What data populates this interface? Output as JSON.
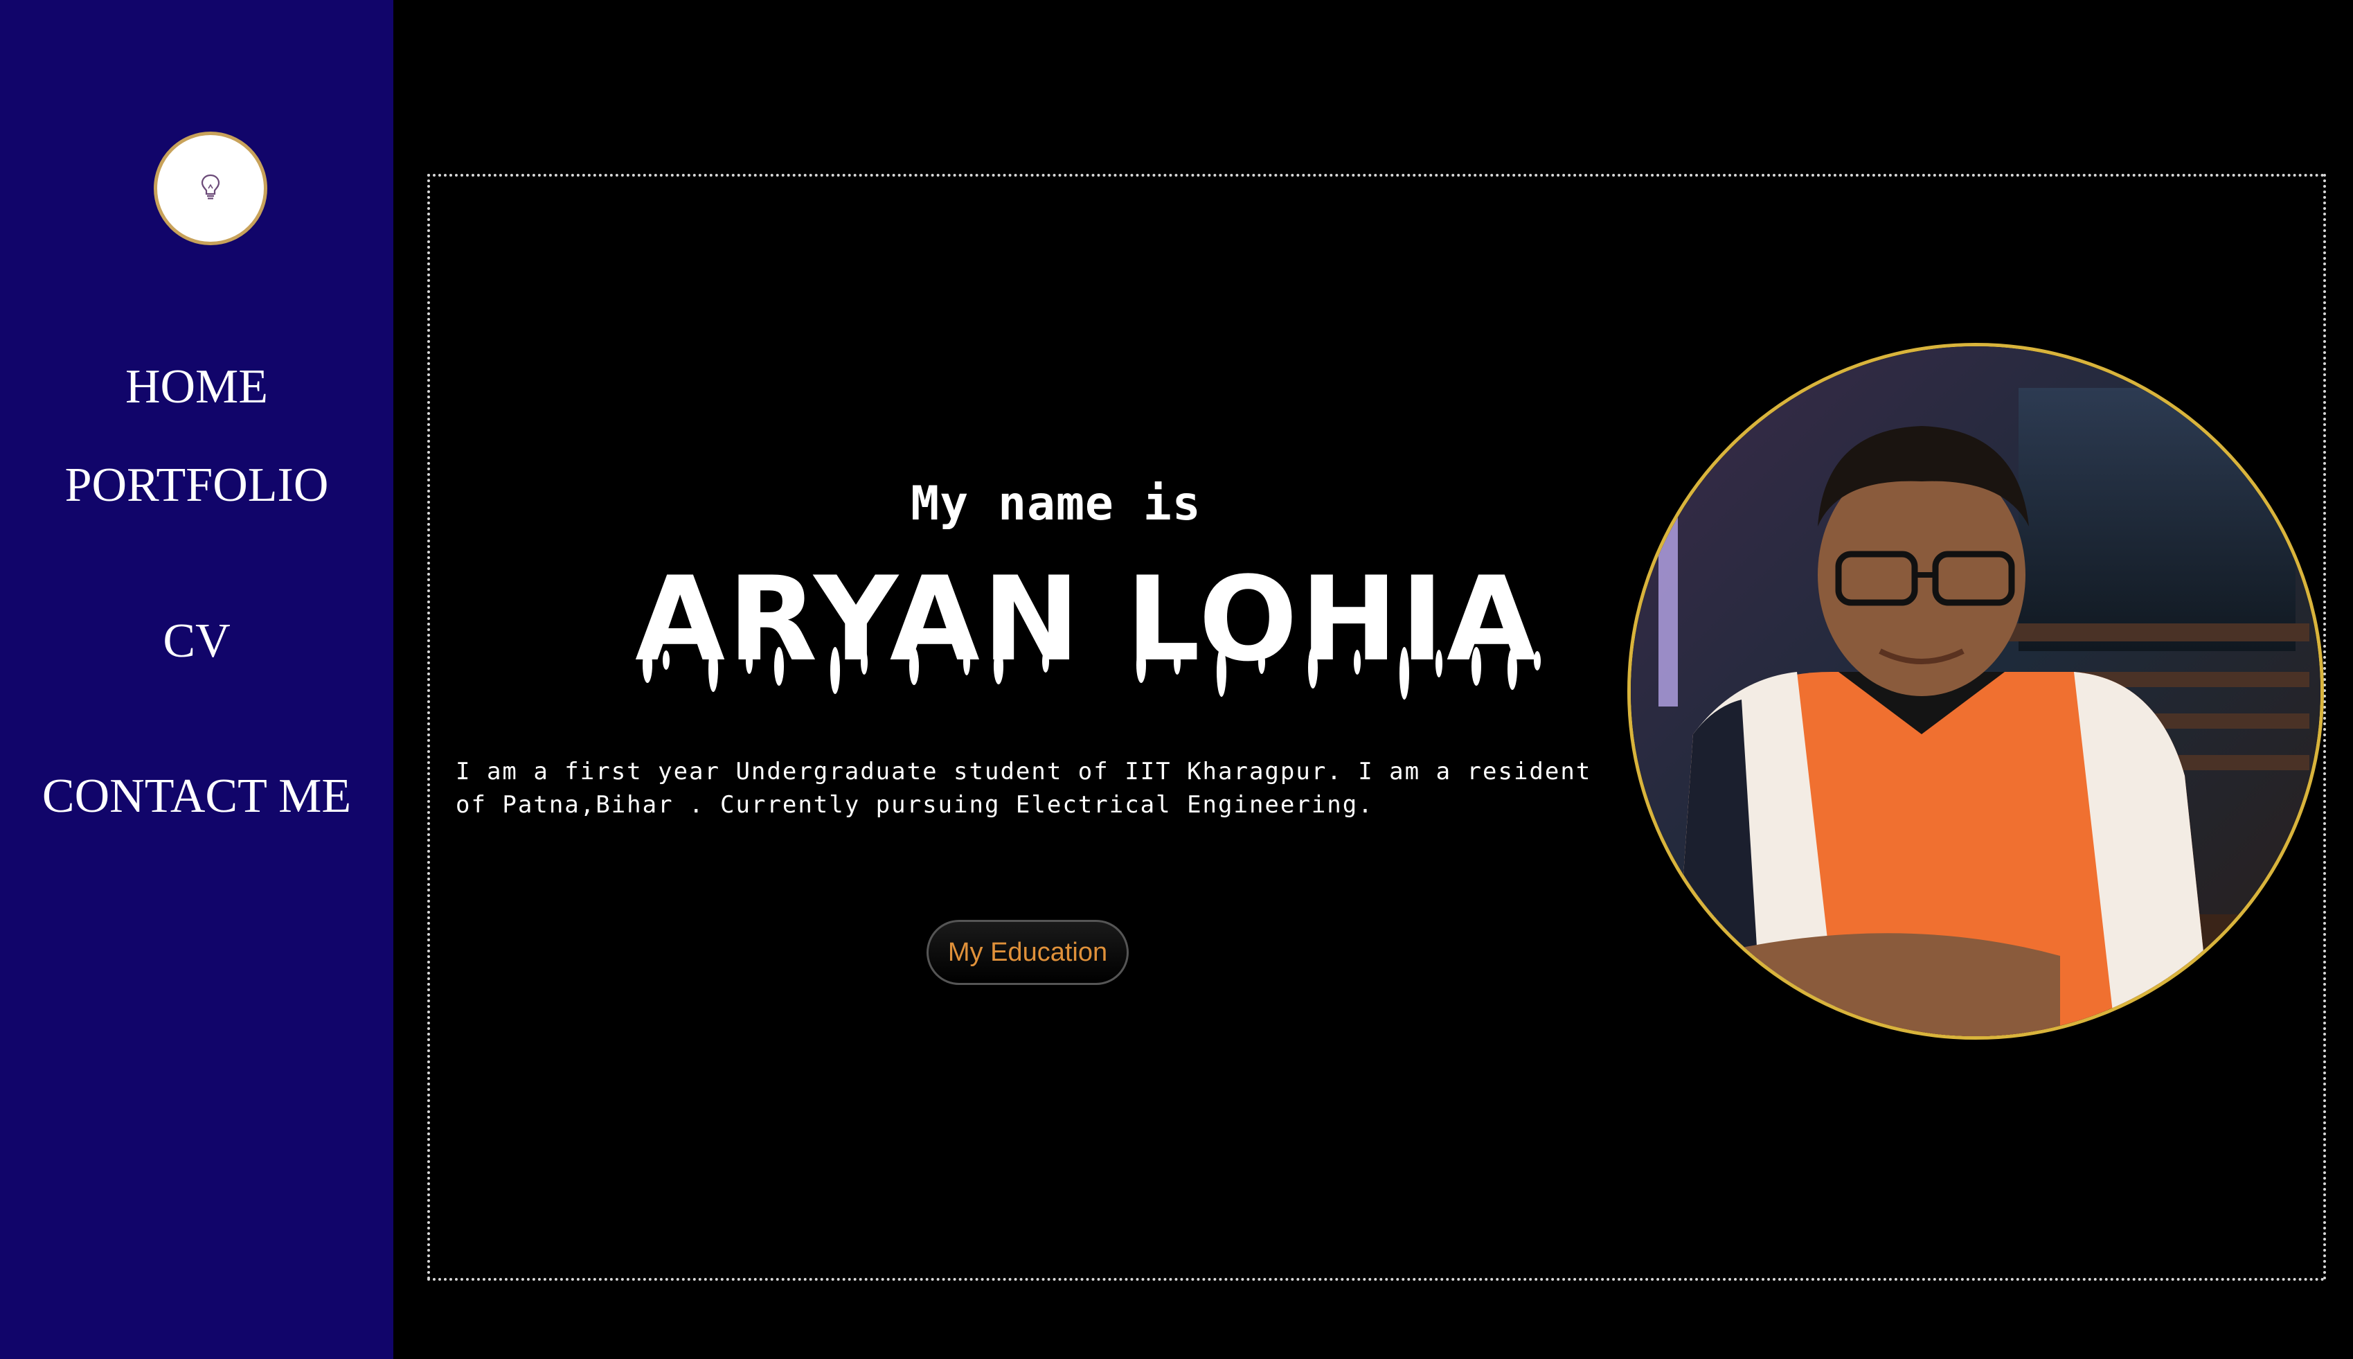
{
  "sidebar": {
    "logo_icon": "lightbulb-icon",
    "nav": [
      {
        "label": "HOME"
      },
      {
        "label": "PORTFOLIO"
      },
      {
        "label": "CV"
      },
      {
        "label": "CONTACT ME"
      }
    ]
  },
  "hero": {
    "intro": "My name is",
    "name": "ARYAN LOHIA",
    "bio": "I am a first year Undergraduate student of IIT Kharagpur. I am a resident of Patna,Bihar . Currently pursuing Electrical Engineering.",
    "button_label": "My Education"
  },
  "colors": {
    "sidebar_bg": "#11056a",
    "page_bg": "#000000",
    "button_text": "#e0913a",
    "photo_border": "#d9b43c",
    "logo_border": "#c8a25a"
  }
}
